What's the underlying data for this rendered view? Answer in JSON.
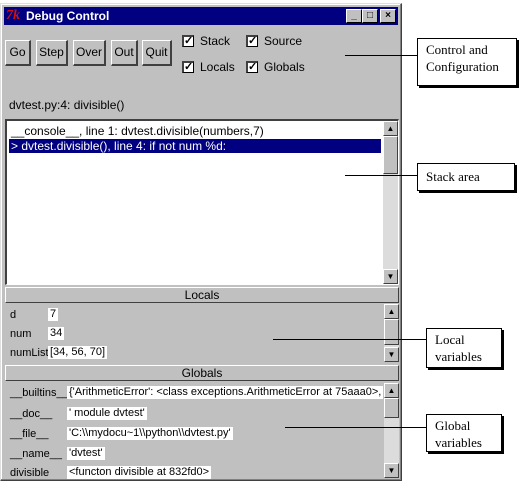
{
  "window": {
    "title": "Debug Control",
    "tk_glyph": "7k",
    "title_buttons": [
      "_",
      "□",
      "×"
    ]
  },
  "toolbar": {
    "buttons": [
      "Go",
      "Step",
      "Over",
      "Out",
      "Quit"
    ],
    "checkboxes": [
      {
        "label": "Stack",
        "checked": true
      },
      {
        "label": "Source",
        "checked": true
      },
      {
        "label": "Locals",
        "checked": true
      },
      {
        "label": "Globals",
        "checked": true
      }
    ],
    "check_mark": "✓"
  },
  "status_text": "dvtest.py:4: divisible()",
  "stack": {
    "lines": [
      "__console__, line 1: dvtest.divisible(numbers,7)",
      "> dvtest.divisible(), line 4: if not num %d:"
    ],
    "selected_index": 1
  },
  "locals": {
    "header": "Locals",
    "vars": [
      {
        "name": "d",
        "value": "7"
      },
      {
        "name": "num",
        "value": "34"
      },
      {
        "name": "numList",
        "value": "[34, 56, 70]"
      }
    ]
  },
  "globals": {
    "header": "Globals",
    "vars": [
      {
        "name": "__builtins__",
        "value": "{'ArithmeticError': <class exceptions.ArithmeticError at 75aaa0>, 'As"
      },
      {
        "name": "__doc__",
        "value": "' module dvtest'"
      },
      {
        "name": "__file__",
        "value": "'C:\\\\mydocu~1\\\\python\\\\dvtest.py'"
      },
      {
        "name": "__name__",
        "value": "'dvtest'"
      },
      {
        "name": "divisible",
        "value": "<functon divisible at 832fd0>"
      }
    ]
  },
  "annotations": {
    "control": [
      "Control and",
      "Configuration"
    ],
    "stack": "Stack area",
    "locals": [
      "Local",
      "variables"
    ],
    "globals": [
      "Global",
      "variables"
    ]
  },
  "scroll_arrows": {
    "up": "▲",
    "down": "▼"
  }
}
